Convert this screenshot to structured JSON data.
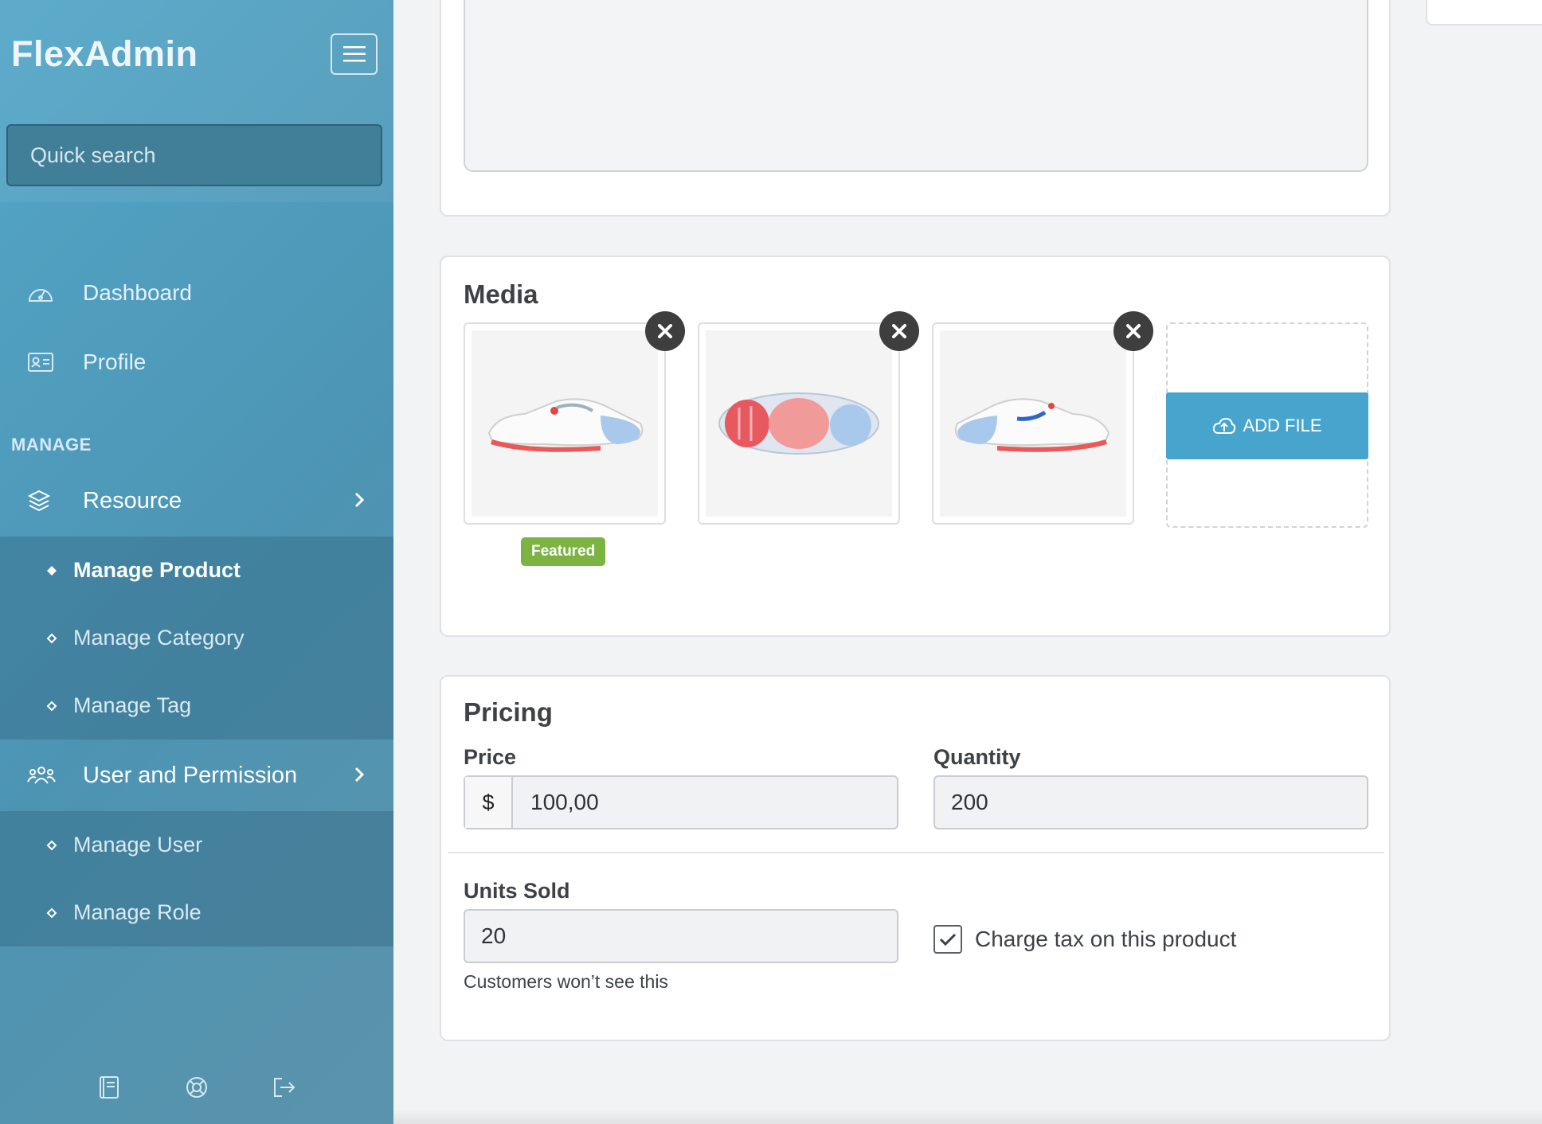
{
  "app": {
    "brand": "FlexAdmin"
  },
  "sidebar": {
    "search_placeholder": "Quick search",
    "nav": [
      {
        "label": "Dashboard",
        "icon": "dashboard-icon"
      },
      {
        "label": "Profile",
        "icon": "profile-card-icon"
      }
    ],
    "section_title": "MANAGE",
    "groups": [
      {
        "label": "Resource",
        "icon": "layers-icon",
        "items": [
          {
            "label": "Manage Product",
            "active": true
          },
          {
            "label": "Manage Category",
            "active": false
          },
          {
            "label": "Manage Tag",
            "active": false
          }
        ]
      },
      {
        "label": "User and Permission",
        "icon": "users-icon",
        "items": [
          {
            "label": "Manage User",
            "active": false
          },
          {
            "label": "Manage Role",
            "active": false
          }
        ]
      }
    ],
    "footer_icons": [
      "book-icon",
      "help-lifebuoy-icon",
      "logout-icon"
    ]
  },
  "media": {
    "title": "Media",
    "images": [
      {
        "icon": "shoe-side-image",
        "featured": true
      },
      {
        "icon": "shoe-sole-image",
        "featured": false
      },
      {
        "icon": "shoe-side-image",
        "featured": false
      }
    ],
    "featured_label": "Featured",
    "add_file_label": "ADD FILE"
  },
  "pricing": {
    "title": "Pricing",
    "price_label": "Price",
    "currency_symbol": "$",
    "price_value": "100,00",
    "quantity_label": "Quantity",
    "quantity_value": "200",
    "units_sold_label": "Units Sold",
    "units_sold_value": "20",
    "units_sold_help": "Customers won’t see this",
    "charge_tax_label": "Charge tax on this product",
    "charge_tax_checked": true
  },
  "colors": {
    "sidebar_gradient_start": "#53a6c8",
    "sidebar_gradient_end": "#5b93ab",
    "accent": "#47a5cd",
    "featured_badge": "#7cb342"
  }
}
